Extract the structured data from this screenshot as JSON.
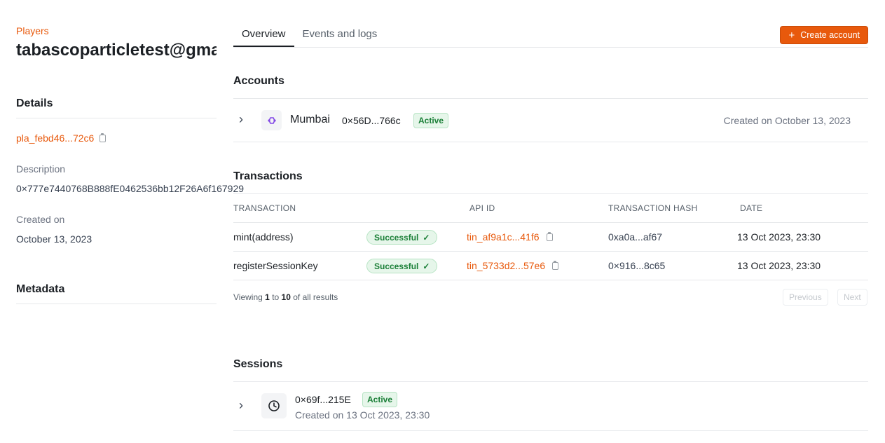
{
  "sidebar": {
    "breadcrumb": "Players",
    "title": "tabascoparticletest@gmail.com",
    "details_heading": "Details",
    "player_id": "pla_febd46...72c6",
    "description_label": "Description",
    "description_value": "0×777e7440768B888fE0462536bb12F26A6f167929",
    "created_label": "Created on",
    "created_value": "October 13, 2023",
    "metadata_heading": "Metadata"
  },
  "tabs": [
    {
      "label": "Overview",
      "active": true
    },
    {
      "label": "Events and logs",
      "active": false
    }
  ],
  "create_account_label": "Create account",
  "accounts": {
    "heading": "Accounts",
    "items": [
      {
        "network": "Mumbai",
        "address": "0×56D...766c",
        "status": "Active",
        "created": "Created on October 13, 2023"
      }
    ]
  },
  "transactions": {
    "heading": "Transactions",
    "columns": [
      "TRANSACTION",
      "API ID",
      "TRANSACTION HASH",
      "DATE"
    ],
    "rows": [
      {
        "fn": "mint(address)",
        "status": "Successful",
        "api_id": "tin_af9a1c...41f6",
        "hash": "0xa0a...af67",
        "date": "13 Oct 2023, 23:30"
      },
      {
        "fn": "registerSessionKey",
        "status": "Successful",
        "api_id": "tin_5733d2...57e6",
        "hash": "0×916...8c65",
        "date": "13 Oct 2023, 23:30"
      }
    ],
    "viewing_prefix": "Viewing",
    "viewing_from": "1",
    "viewing_to_word": "to",
    "viewing_to": "10",
    "viewing_suffix": "of all results",
    "prev_label": "Previous",
    "next_label": "Next"
  },
  "sessions": {
    "heading": "Sessions",
    "items": [
      {
        "address": "0×69f...215E",
        "status": "Active",
        "created": "Created on 13 Oct 2023, 23:30"
      }
    ]
  },
  "colors": {
    "accent": "#e8590c",
    "success_bg": "#e6f6ea",
    "success_text": "#1a7f37",
    "polygon": "#8247e5"
  }
}
